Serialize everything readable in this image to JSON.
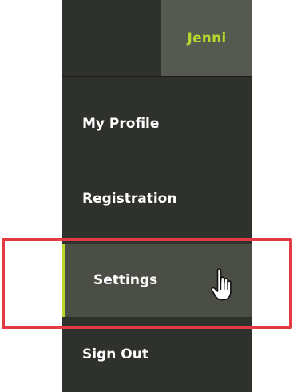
{
  "header": {
    "user_name": "Jenni"
  },
  "menu": {
    "items": [
      {
        "label": "My Profile"
      },
      {
        "label": "Registration"
      },
      {
        "label": "Settings",
        "active": true
      },
      {
        "label": "Sign Out"
      }
    ]
  },
  "colors": {
    "panel_background": "#2f312d",
    "active_item_background": "#4a4e45",
    "user_button_background": "#55594f",
    "accent": "#b6d72c",
    "highlight_border": "#e23b43",
    "text": "#ffffff"
  },
  "icons": {
    "cursor": "hand-pointer-icon"
  }
}
